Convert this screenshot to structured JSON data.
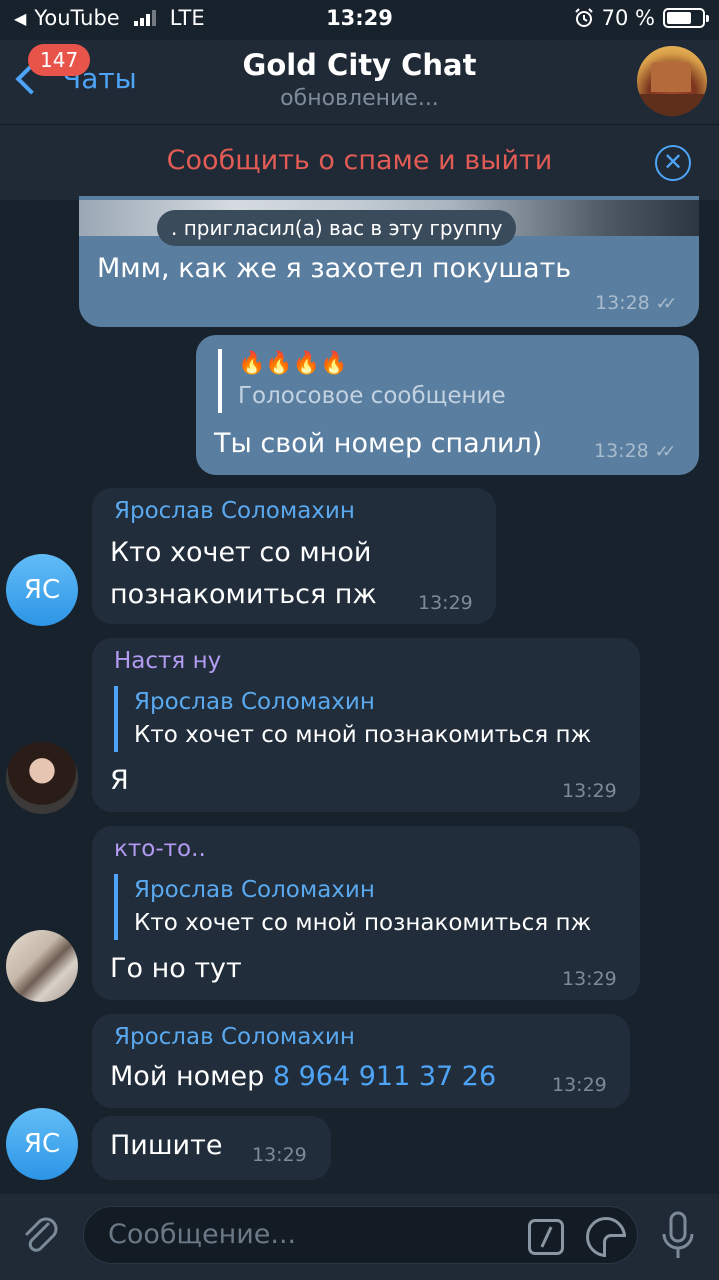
{
  "status_bar": {
    "back_app": "YouTube",
    "network": "LTE",
    "time": "13:29",
    "battery": "70 %",
    "battery_level": 0.7
  },
  "header": {
    "back_label": "Чаты",
    "unread_badge": "147",
    "title": "Gold City Chat",
    "subtitle": "обновление..."
  },
  "spam_bar": {
    "label": "Сообщить о спаме и выйти"
  },
  "messages": {
    "m1": {
      "service": ". пригласил(а) вас в эту группу",
      "text": "Ммм, как же я захотел покушать",
      "time": "13:28"
    },
    "m2": {
      "reply_emoji": "🔥🔥🔥🔥",
      "reply_text": "Голосовое сообщение",
      "text": "Ты свой номер спалил)",
      "time": "13:28"
    },
    "m3": {
      "avatar": "ЯС",
      "sender": "Ярослав Соломахин",
      "text_line1": "Кто хочет со мной",
      "text_line2": "познакомиться пж",
      "time": "13:29"
    },
    "m4": {
      "sender": "Настя ну",
      "reply_name": "Ярослав Соломахин",
      "reply_text": "Кто хочет со мной познакомиться пж",
      "text": "Я",
      "time": "13:29"
    },
    "m5": {
      "sender": "кто-то..",
      "reply_name": "Ярослав Соломахин",
      "reply_text": "Кто хочет со мной познакомиться пж",
      "text": "Го но тут",
      "time": "13:29"
    },
    "m6": {
      "sender": "Ярослав Соломахин",
      "text": "Мой номер",
      "phone": "8 964 911 37 26",
      "time": "13:29"
    },
    "m7": {
      "avatar": "ЯС",
      "text": "Пишите",
      "time": "13:29"
    }
  },
  "input_bar": {
    "placeholder": "Сообщение..."
  },
  "colors": {
    "background": "#18222d",
    "outgoing_bubble": "#5a7ea0",
    "incoming_bubble": "#212d3b",
    "accent": "#4ea4f6",
    "spam": "#e25b55"
  },
  "icons": [
    "back-chevron-icon",
    "alarm-icon",
    "battery-icon",
    "close-circle-icon",
    "double-check-icon",
    "attach-icon",
    "command-icon",
    "sticker-icon",
    "microphone-icon"
  ]
}
